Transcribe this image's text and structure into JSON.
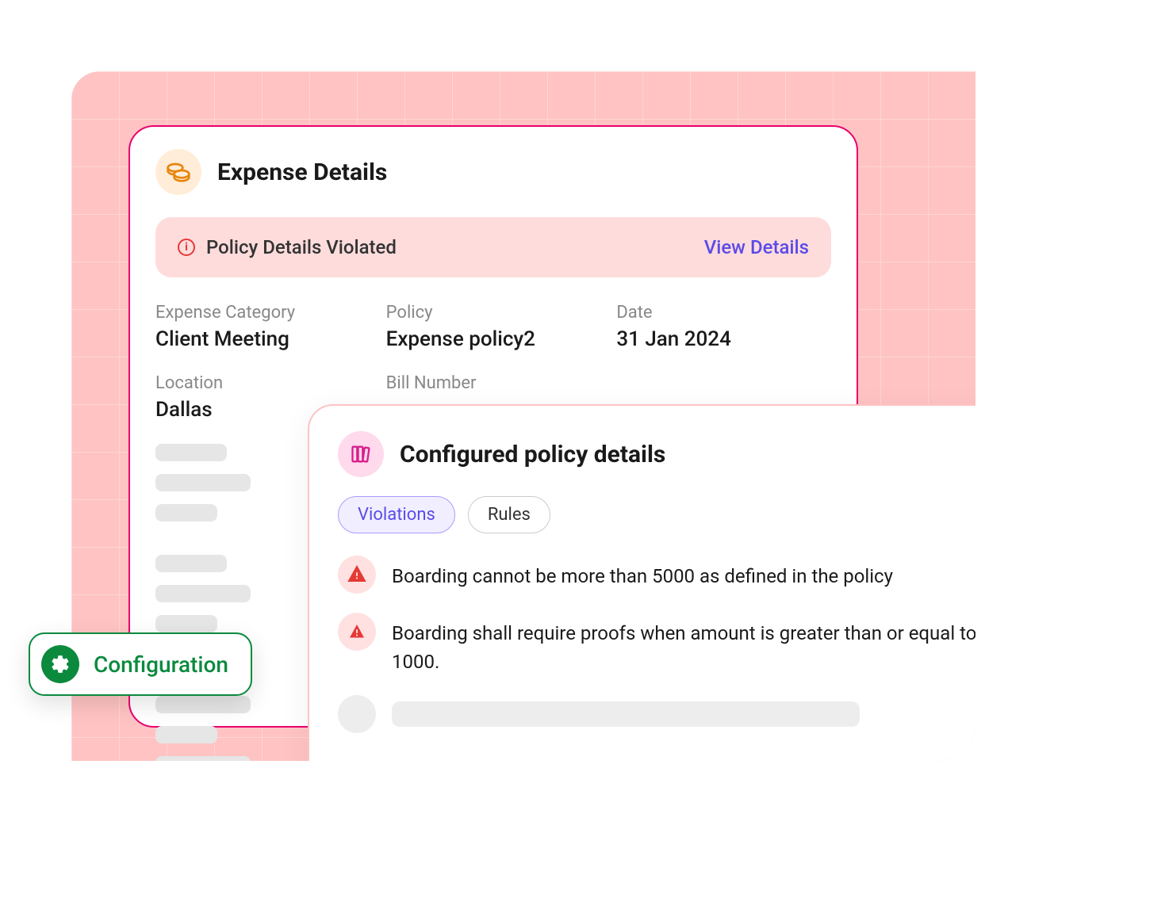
{
  "expense_card": {
    "title": "Expense Details",
    "banner": {
      "text": "Policy Details Violated",
      "link": "View Details"
    },
    "fields": {
      "category_label": "Expense Category",
      "category_value": "Client Meeting",
      "policy_label": "Policy",
      "policy_value": "Expense policy2",
      "date_label": "Date",
      "date_value": "31 Jan 2024",
      "location_label": "Location",
      "location_value": "Dallas",
      "bill_label": "Bill Number",
      "bill_value": ""
    }
  },
  "policy_card": {
    "title": "Configured policy details",
    "tabs": {
      "violations": "Violations",
      "rules": "Rules"
    },
    "violations": [
      "Boarding cannot be more than 5000 as defined in the policy",
      "Boarding shall require proofs when amount is greater than or equal to 1000."
    ]
  },
  "config_pill": {
    "label": "Configuration"
  },
  "colors": {
    "accent_pink": "#E8006F",
    "accent_green": "#0B8A3E",
    "accent_purple": "#5B4BE8",
    "alert_red": "#E53935"
  }
}
